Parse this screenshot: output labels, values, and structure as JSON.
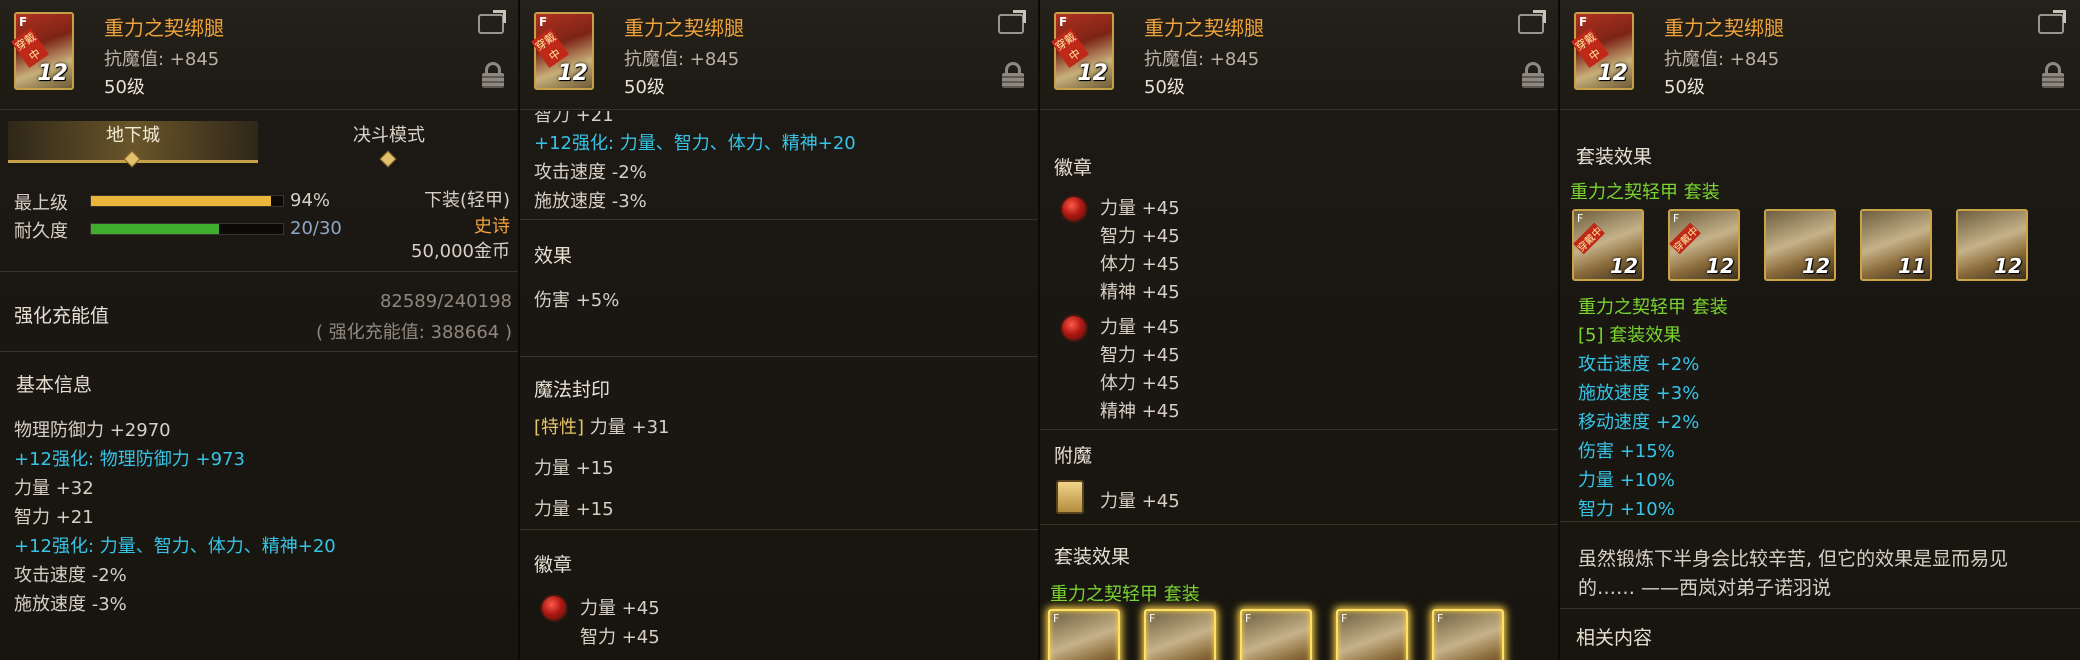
{
  "item": {
    "name": "重力之契绑腿",
    "attr": "抗魔值: +845",
    "level": "50级",
    "icon_badge": "穿戴中",
    "icon_f": "F",
    "icon_level": "12"
  },
  "p1": {
    "tab_dungeon": "地下城",
    "tab_duel": "决斗模式",
    "grade_label": "最上级",
    "grade_pct": "94%",
    "grade_value": 0.94,
    "dur_label": "耐久度",
    "dur_value": "20/30",
    "dur_fraction": 0.667,
    "type": "下装(轻甲)",
    "rarity": "史诗",
    "price": "50,000金币",
    "charge_label": "强化充能值",
    "charge_value": "82589/240198",
    "charge_total": "( 强化充能值: 388664 )",
    "basic_title": "基本信息",
    "lines": [
      {
        "text": "物理防御力 +2970",
        "cls": ""
      },
      {
        "text": "+12强化: 物理防御力 +973",
        "cls": "cyan"
      },
      {
        "text": "力量 +32",
        "cls": ""
      },
      {
        "text": "智力 +21",
        "cls": ""
      },
      {
        "text": "+12强化: 力量、智力、体力、精神+20",
        "cls": "cyan"
      },
      {
        "text": "攻击速度 -2%",
        "cls": ""
      },
      {
        "text": "施放速度 -3%",
        "cls": ""
      }
    ]
  },
  "p2": {
    "top_cut": "智力 +21",
    "l1": "+12强化: 力量、智力、体力、精神+20",
    "l2": "攻击速度 -2%",
    "l3": "施放速度 -3%",
    "effect_title": "效果",
    "effect": "伤害 +5%",
    "seal_title": "魔法封印",
    "seal_tag": "[特性]",
    "seal_1": "力量 +31",
    "seal_2": "力量 +15",
    "seal_3": "力量 +15",
    "emblem_title": "徽章",
    "emblem_1": "力量 +45",
    "emblem_2": "智力 +45"
  },
  "p3": {
    "emblem_title": "徽章",
    "group1": [
      "力量 +45",
      "智力 +45",
      "体力 +45",
      "精神 +45"
    ],
    "group2": [
      "力量 +45",
      "智力 +45",
      "体力 +45",
      "精神 +45"
    ],
    "enchant_title": "附魔",
    "enchant": "力量 +45",
    "set_title": "套装效果",
    "set_name": "重力之契轻甲 套装"
  },
  "p4": {
    "set_title": "套装效果",
    "set_name": "重力之契轻甲 套装",
    "set_icons": [
      {
        "f": "F",
        "badge": "穿戴中",
        "lv": "12"
      },
      {
        "f": "F",
        "badge": "穿戴中",
        "lv": "12"
      },
      {
        "f": "",
        "badge": "",
        "lv": "12"
      },
      {
        "f": "",
        "badge": "",
        "lv": "11"
      },
      {
        "f": "",
        "badge": "",
        "lv": "12"
      }
    ],
    "set_name2": "重力之契轻甲 套装",
    "set_count": "[5] 套装效果",
    "effects": [
      "攻击速度 +2%",
      "施放速度 +3%",
      "移动速度 +2%",
      "伤害 +15%",
      "力量 +10%",
      "智力 +10%"
    ],
    "flavor_1": "虽然锻炼下半身会比较辛苦, 但它的效果是显而易见",
    "flavor_2": "的…… ——西岚对弟子诺羽说",
    "related": "相关内容"
  },
  "colors": {
    "gold": "#f0a33a",
    "cyan": "#36c4e6",
    "green": "#7ad431",
    "durability": "#3fae2e",
    "grade": "#e9b53b"
  }
}
